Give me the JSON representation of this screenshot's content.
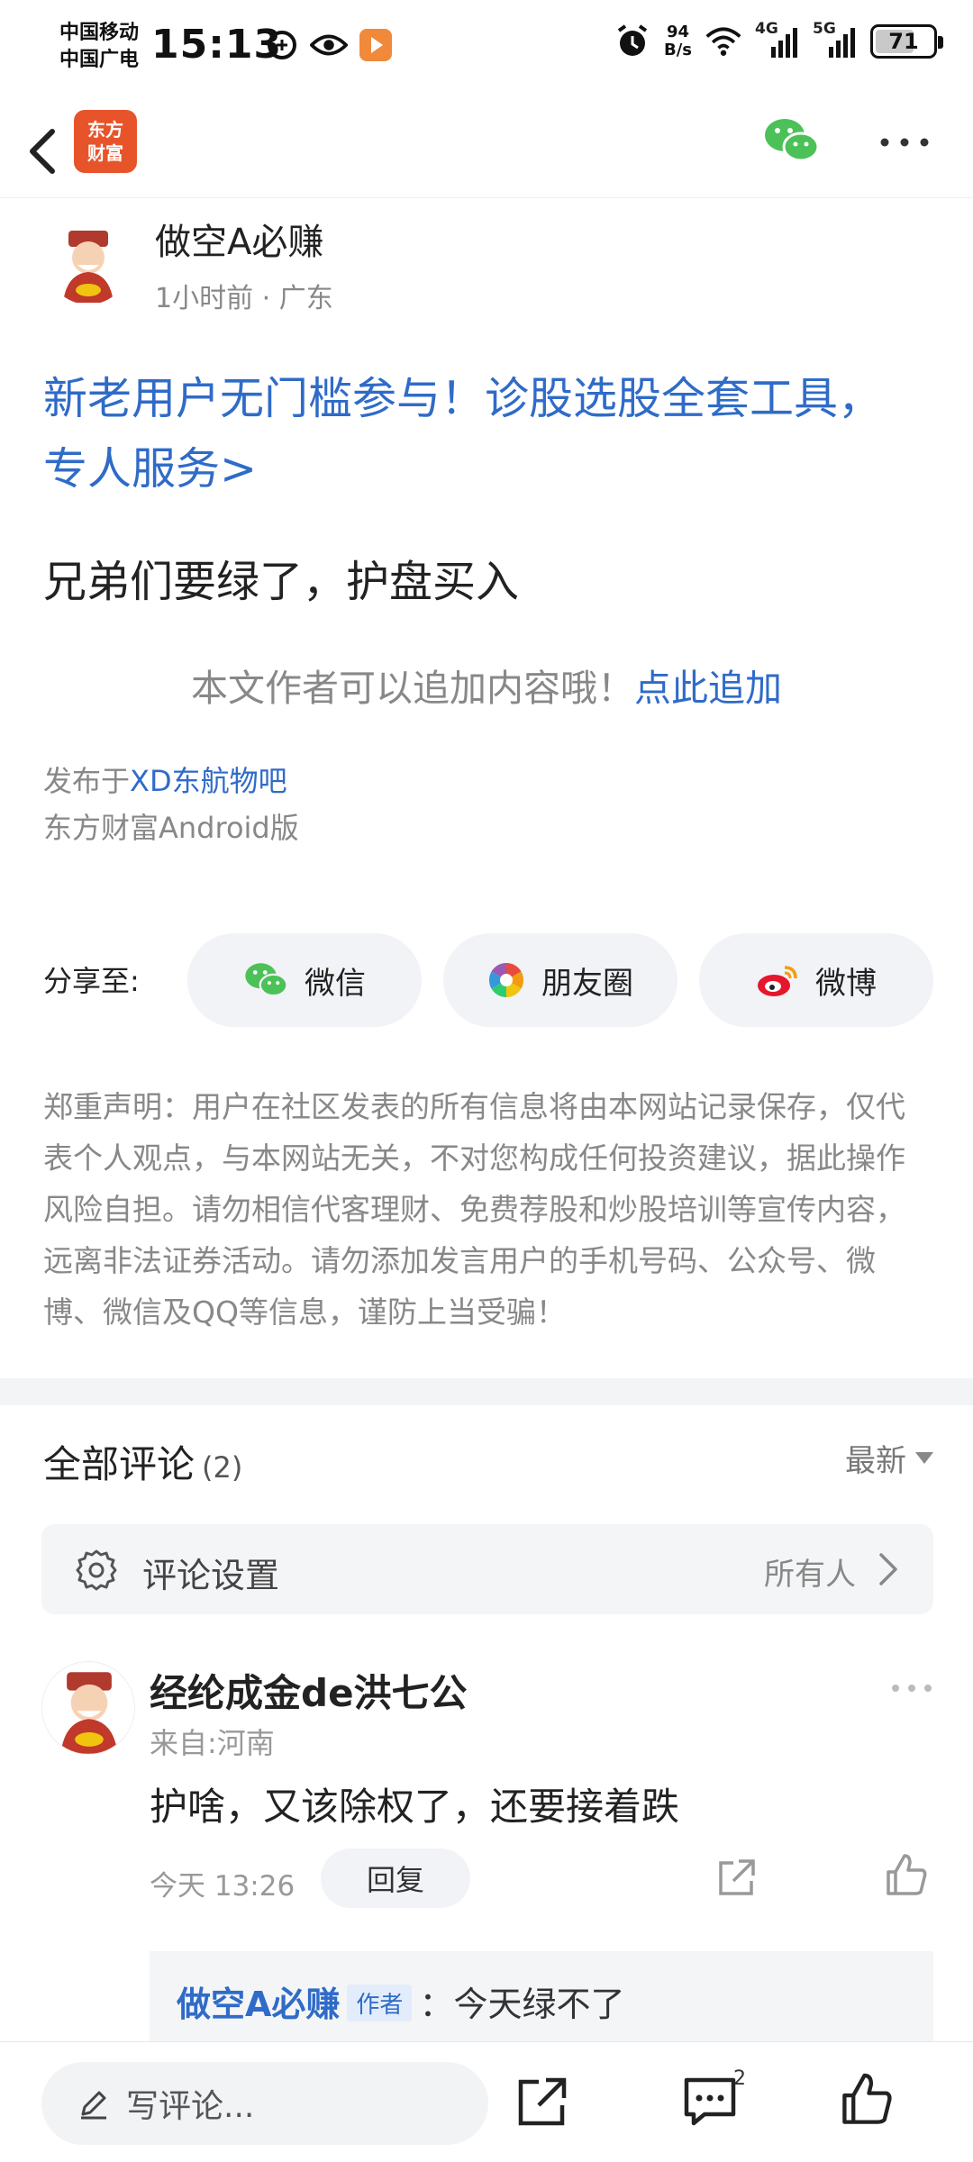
{
  "status_bar": {
    "carrier_1": "中国移动",
    "carrier_2": "中国广电",
    "time": "15:13",
    "net_speed_value": "94",
    "net_speed_unit": "B/s",
    "signal_1": "4G",
    "signal_2": "5G",
    "battery": "71",
    "battery_level": 0.71
  },
  "header": {
    "logo_line1": "东方",
    "logo_line2": "财富"
  },
  "post": {
    "author": "做空A必赚",
    "meta": "1小时前 · 广东",
    "promo": "新老用户无门槛参与！诊股选股全套工具，专人服务>",
    "body": "兄弟们要绿了，护盘买入",
    "append_prompt": "本文作者可以追加内容哦！",
    "append_link": "点此追加",
    "published_prefix": "发布于",
    "published_bar": "XD东航物吧",
    "client": "东方财富Android版"
  },
  "share": {
    "label": "分享至:",
    "wechat": "微信",
    "moments": "朋友圈",
    "weibo": "微博"
  },
  "disclaimer": "郑重声明：用户在社区发表的所有信息将由本网站记录保存，仅代表个人观点，与本网站无关，不对您构成任何投资建议，据此操作风险自担。请勿相信代客理财、免费荐股和炒股培训等宣传内容，远离非法证券活动。请勿添加发言用户的手机号码、公众号、微博、微信及QQ等信息，谨防上当受骗！",
  "comments": {
    "title": "全部评论",
    "count": "(2)",
    "sort": "最新",
    "settings_label": "评论设置",
    "settings_value": "所有人",
    "items": [
      {
        "name": "经纶成金de洪七公",
        "from": "来自:河南",
        "text": "护啥，又该除权了，还要接着跌",
        "time": "今天 13:26",
        "reply_label": "回复",
        "sub_reply": {
          "name": "做空A必赚",
          "badge": "作者",
          "text": "：今天绿不了"
        }
      }
    ]
  },
  "bottom_bar": {
    "write_placeholder": "写评论...",
    "comment_count": "2"
  }
}
